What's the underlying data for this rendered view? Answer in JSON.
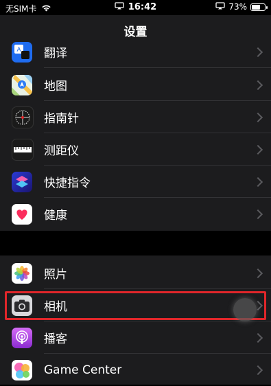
{
  "status": {
    "carrier": "无SIM卡",
    "time": "16:42",
    "battery_pct": "73%",
    "battery_level": 0.73
  },
  "nav": {
    "title": "设置"
  },
  "groups": [
    {
      "items": [
        {
          "label": "翻译",
          "icon": "translate-icon"
        },
        {
          "label": "地图",
          "icon": "maps-icon"
        },
        {
          "label": "指南针",
          "icon": "compass-icon"
        },
        {
          "label": "测距仪",
          "icon": "measure-icon"
        },
        {
          "label": "快捷指令",
          "icon": "shortcuts-icon"
        },
        {
          "label": "健康",
          "icon": "health-icon"
        }
      ]
    },
    {
      "items": [
        {
          "label": "照片",
          "icon": "photos-icon"
        },
        {
          "label": "相机",
          "icon": "camera-icon",
          "highlighted": true
        },
        {
          "label": "播客",
          "icon": "podcasts-icon"
        },
        {
          "label": "Game Center",
          "icon": "game-center-icon"
        }
      ]
    }
  ],
  "colors": {
    "highlight": "#e0262a",
    "background": "#000000",
    "cell": "#1c1c1e"
  }
}
